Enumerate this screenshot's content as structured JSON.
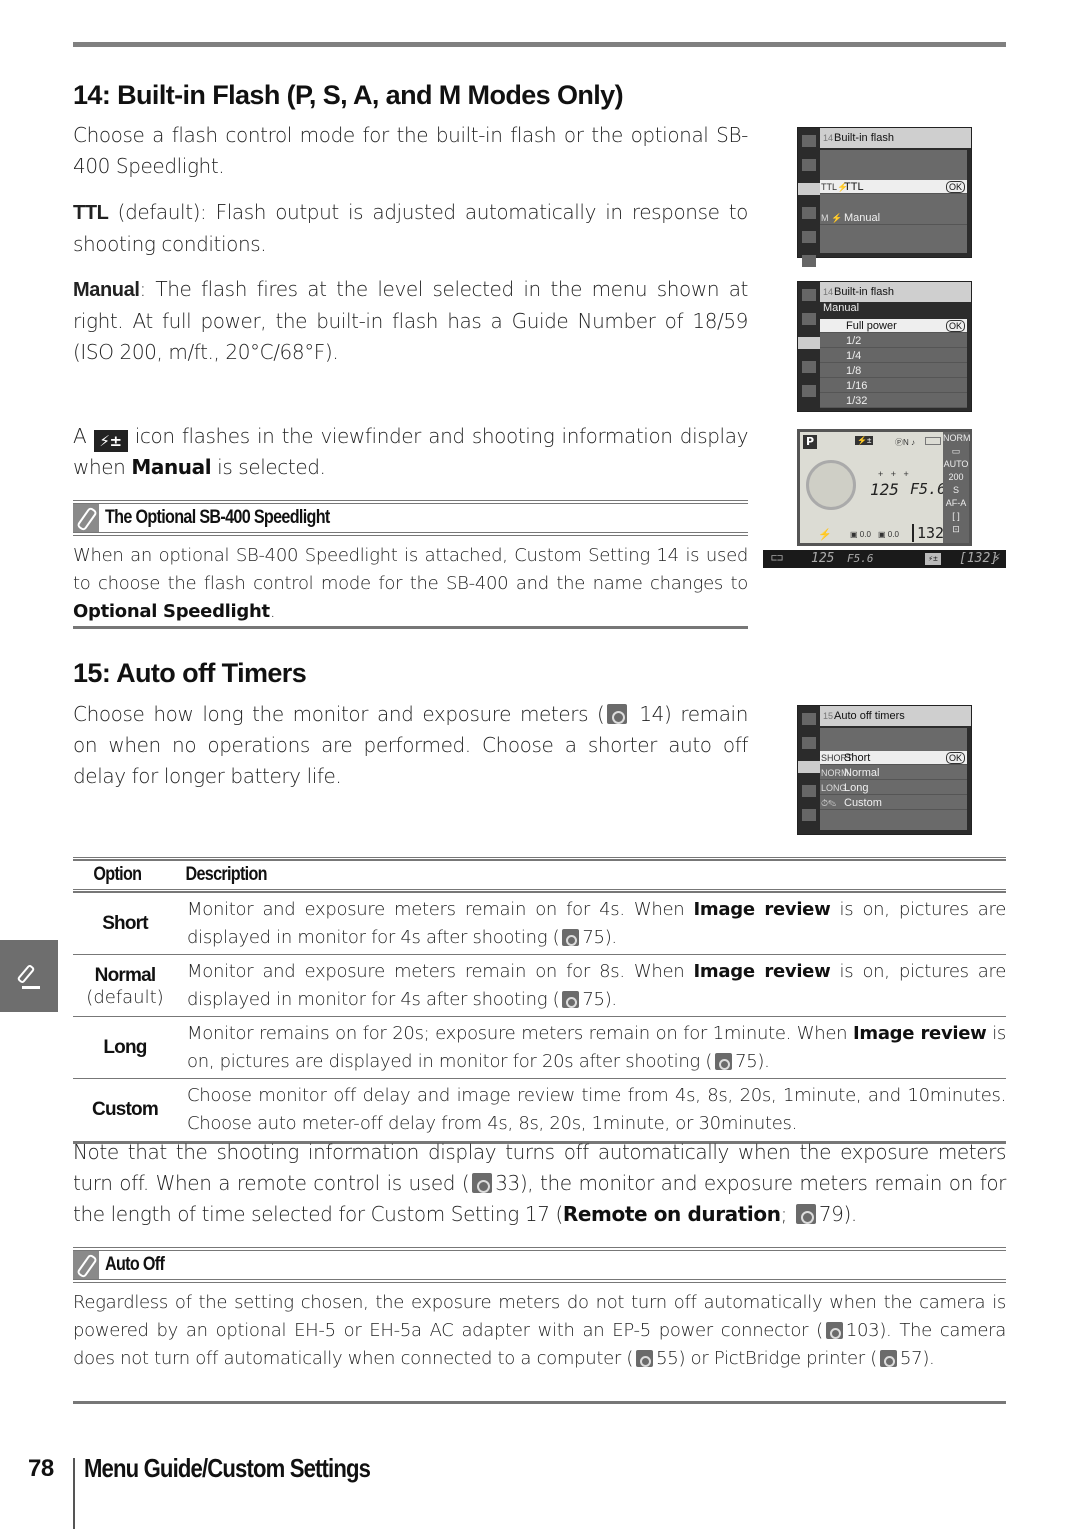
{
  "section14": {
    "title": "14: Built-in Flash (P, S, A, and M Modes Only)",
    "intro": "Choose a flash control mode for the built-in flash or the optional SB-400 Speedlight.",
    "ttl_label": "TTL",
    "ttl_text": " (default): Flash output is adjusted automatically in response to shooting conditions.",
    "manual_label": "Manual",
    "manual_text": ": The flash fires at the level selected in the menu shown at right.  At full power, the built-in flash has a Guide Number of 18/59 (ISO 200, m/ft., 20°C/68°F).",
    "icon_para_before": "A",
    "icon_para_icon": "flash-compensation-icon",
    "icon_para_after": " icon flashes in the viewfinder and shooting information display when ",
    "icon_para_bold": "Manual",
    "icon_para_end": " is selected."
  },
  "note_sb400": {
    "title": "The Optional SB-400 Speedlight",
    "body": "When an optional SB-400 Speedlight is attached, Custom Setting 14 is used to choose the flash control mode for the SB-400 and the name changes to ",
    "bold": "Optional Speedlight",
    "end": "."
  },
  "screen_flash1": {
    "num": "14",
    "title": "Built-in flash",
    "items": [
      {
        "code": "TTL⚡",
        "label": "TTL",
        "selected": true,
        "ok": "OK"
      },
      {
        "code": "M ⚡",
        "label": "Manual",
        "selected": false
      }
    ]
  },
  "screen_flash2": {
    "num": "14",
    "title": "Built-in flash",
    "subtitle": "Manual",
    "items": [
      {
        "label": "Full power",
        "selected": true,
        "ok": "OK"
      },
      {
        "label": "1/2"
      },
      {
        "label": "1/4"
      },
      {
        "label": "1/8"
      },
      {
        "label": "1/16"
      },
      {
        "label": "1/32"
      }
    ]
  },
  "info_display": {
    "mode": "P",
    "shutter": "125",
    "aperture": "F5.6",
    "count": "132",
    "right_column": [
      "NORM",
      "▭",
      "AUTO",
      "200",
      "S",
      "AF-A",
      "[ ]",
      "⊡"
    ],
    "exp_comp": "0.0",
    "flash_comp": "0.0",
    "top_icons": "ⓅN ♪"
  },
  "viewfinder": {
    "shutter": "125",
    "aperture": "F5.6",
    "count": "[132]",
    "flash": "⚡"
  },
  "section15": {
    "title": "15: Auto off Timers",
    "intro_before": "Choose how long the monitor and exposure meters (",
    "intro_ref": "14",
    "intro_after": ") remain on when no operations are performed.  Choose a shorter auto off delay for longer battery life."
  },
  "screen_timers": {
    "num": "15",
    "title": "Auto off timers",
    "items": [
      {
        "code": "SHORT",
        "label": "Short",
        "selected": true,
        "ok": "OK"
      },
      {
        "code": "NORM",
        "label": "Normal"
      },
      {
        "code": "LONG",
        "label": "Long"
      },
      {
        "code": "⏱✎",
        "label": "Custom"
      }
    ]
  },
  "table": {
    "headers": [
      "Option",
      "Description"
    ],
    "rows": [
      {
        "option": "Short",
        "sub": "",
        "desc_a": "Monitor and exposure meters remain on for 4s.  When ",
        "bold": "Image review",
        "desc_b": " is on, pictures are displayed in monitor for 4s after shooting (",
        "ref": "75",
        "desc_c": ")."
      },
      {
        "option": "Normal",
        "sub": "(default)",
        "desc_a": "Monitor and exposure meters remain on for 8s.  When ",
        "bold": "Image review",
        "desc_b": " is on, pictures are displayed in monitor for 4s after shooting (",
        "ref": "75",
        "desc_c": ")."
      },
      {
        "option": "Long",
        "sub": "",
        "desc_a": "Monitor remains on for 20s; exposure meters remain on for 1minute.  When ",
        "bold": "Image review",
        "desc_b": " is on, pictures are displayed in monitor for 20s after shooting (",
        "ref": "75",
        "desc_c": ")."
      },
      {
        "option": "Custom",
        "sub": "",
        "desc_a": "Choose monitor off delay and image review time from 4s, 8s, 20s, 1minute, and 10minutes.  Choose auto meter-off delay from 4s, 8s, 20s, 1minute, or 30minutes.",
        "bold": "",
        "desc_b": "",
        "ref": "",
        "desc_c": ""
      }
    ]
  },
  "note_para": {
    "a": "Note that the shooting information display turns off automatically when the exposure meters turn off.  When a remote control is used (",
    "ref1": "33",
    "b": "), the monitor and exposure meters remain on for the length of time selected for Custom Setting 17 (",
    "bold": "Remote on duration",
    "c": "; ",
    "ref2": "79",
    "d": ")."
  },
  "note_autooff": {
    "title": "Auto Off",
    "a": "Regardless of the setting chosen, the exposure meters do not turn off automatically when the camera is powered by an optional EH-5 or EH-5a AC adapter with an EP-5 power connector (",
    "ref1": "103",
    "b": ").  The camera does not turn off automatically when connected to a computer (",
    "ref2": "55",
    "c": ") or PictBridge printer (",
    "ref3": "57",
    "d": ")."
  },
  "footer": {
    "page_number": "78",
    "section": "Menu Guide/Custom Settings"
  }
}
